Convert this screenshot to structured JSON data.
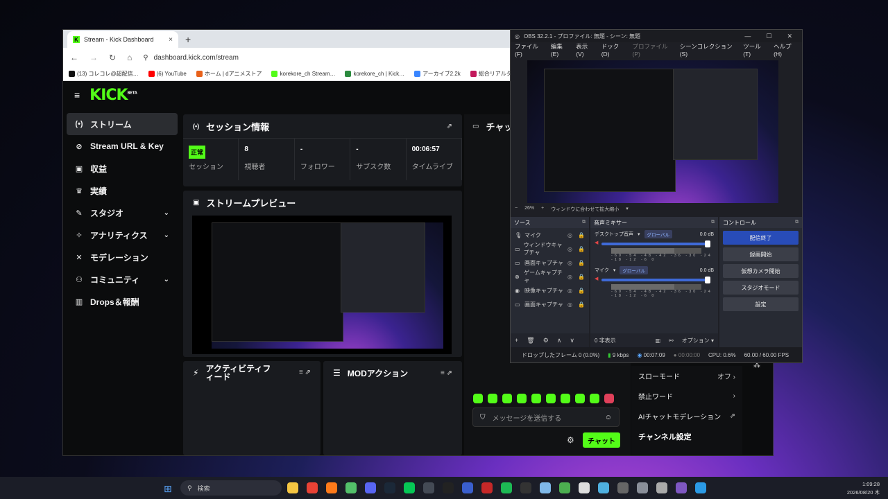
{
  "browser": {
    "tab_title": "Stream - Kick Dashboard",
    "new_tab": "+",
    "close_tab": "×",
    "url": "dashboard.kick.com/stream",
    "bookmarks": [
      {
        "label": "(13) コレコレ@超配信…",
        "color": "#111111"
      },
      {
        "label": "(6) YouTube",
        "color": "#ff0000"
      },
      {
        "label": "ホーム | dアニメストア",
        "color": "#e8611a"
      },
      {
        "label": "korekore_ch Stream…",
        "color": "#53fc18"
      },
      {
        "label": "korekore_ch | Kick…",
        "color": "#2b8a3e"
      },
      {
        "label": "アーカイブ2.2k",
        "color": "#3a86ff"
      },
      {
        "label": "総合リアルタイムランキ…",
        "color": "#c2185b"
      }
    ]
  },
  "kick": {
    "logo": "KICK",
    "logo_beta": "BETA",
    "sidebar": [
      {
        "label": "ストリーム",
        "icon": "broadcast-icon",
        "glyph": "(•)",
        "active": true
      },
      {
        "label": "Stream URL & Key",
        "icon": "link-icon",
        "glyph": "⊘"
      },
      {
        "label": "収益",
        "icon": "money-icon",
        "glyph": "▣"
      },
      {
        "label": "実績",
        "icon": "trophy-icon",
        "glyph": "♛"
      },
      {
        "label": "スタジオ",
        "icon": "studio-icon",
        "glyph": "✎",
        "chevron": "⌄"
      },
      {
        "label": "アナリティクス",
        "icon": "analytics-icon",
        "glyph": "✧",
        "chevron": "⌄"
      },
      {
        "label": "モデレーション",
        "icon": "wrench-icon",
        "glyph": "✕"
      },
      {
        "label": "コミュニティ",
        "icon": "community-icon",
        "glyph": "⚇",
        "chevron": "⌄"
      },
      {
        "label": "Drops＆報酬",
        "icon": "gift-icon",
        "glyph": "▥"
      }
    ],
    "session": {
      "title": "セッション情報",
      "status": "正常",
      "stats": [
        {
          "value": "",
          "label": "セッション"
        },
        {
          "value": "8",
          "label": "視聴者"
        },
        {
          "value": "-",
          "label": "フォロワー"
        },
        {
          "value": "-",
          "label": "サブスク数"
        },
        {
          "value": "00:06:57",
          "label": "タイムライブ"
        }
      ]
    },
    "preview_title": "ストリームプレビュー",
    "activity_title": "アクティビティフィード",
    "mod_title": "MODアクション",
    "chat_title": "チャット",
    "chat_placeholder": "メッセージを送信する",
    "chat_button": "チャット",
    "settings": [
      {
        "label": "スローモード",
        "value": "オフ",
        "glyph": "›"
      },
      {
        "label": "禁止ワード",
        "value": "",
        "glyph": "›"
      },
      {
        "label": "AIチャットモデレーション",
        "value": "",
        "glyph": "⇗"
      }
    ],
    "channel_settings": "チャンネル設定"
  },
  "obs": {
    "title": "OBS 32.2.1 - プロファイル: 無題 - シーン: 無題",
    "menu": [
      {
        "label": "ファイル(F)"
      },
      {
        "label": "編集(E)"
      },
      {
        "label": "表示(V)"
      },
      {
        "label": "ドック(D)"
      },
      {
        "label": "プロファイル(P)",
        "disabled": true
      },
      {
        "label": "シーンコレクション(S)"
      },
      {
        "label": "ツール(T)"
      },
      {
        "label": "ヘルプ(H)"
      }
    ],
    "zoom": "26%",
    "zoom_label": "ウィンドウに合わせて拡大縮小",
    "sources_title": "ソース",
    "sources": [
      {
        "label": "マイク",
        "icon": "mic-icon",
        "glyph": "🎙"
      },
      {
        "label": "ウィンドウキャプチャ",
        "icon": "window-icon",
        "glyph": "▭"
      },
      {
        "label": "画面キャプチャ",
        "icon": "monitor-icon",
        "glyph": "▭"
      },
      {
        "label": "ゲームキャプチャ",
        "icon": "gamepad-icon",
        "glyph": "⊗"
      },
      {
        "label": "映像キャプチャ",
        "icon": "camera-icon",
        "glyph": "◉"
      },
      {
        "label": "画面キャプチャ",
        "icon": "monitor-icon",
        "glyph": "▭"
      }
    ],
    "mixer_title": "音声ミキサー",
    "mixer": [
      {
        "name": "デスクトップ音声",
        "db": "0.0 dB",
        "global": "グローバル"
      },
      {
        "name": "マイク",
        "db": "0.0 dB",
        "global": "グローバル"
      }
    ],
    "meter_scale": "-60 -54 -48 -42 -36 -30 -24 -18 -12 -6 0",
    "hidden_count": "0 非表示",
    "options": "オプション",
    "controls_title": "コントロール",
    "controls": [
      "配信終了",
      "録画開始",
      "仮想カメラ開始",
      "スタジオモード",
      "設定"
    ],
    "status": {
      "dropped": "ドロップしたフレーム 0 (0.0%)",
      "kbps": "9 kbps",
      "stream_time": "00:07:09",
      "rec_time": "00:00:00",
      "cpu": "CPU: 0.6%",
      "fps": "60.00 / 60.00 FPS"
    }
  },
  "taskbar": {
    "search": "検索",
    "time": "1:09:28",
    "date": "2026/08/20 木",
    "apps": [
      {
        "name": "file-explorer-icon",
        "color": "#f5c542"
      },
      {
        "name": "chrome-icon",
        "color": "#e94235"
      },
      {
        "name": "firefox-icon",
        "color": "#ff7a1a"
      },
      {
        "name": "app-icon",
        "color": "#53c06a"
      },
      {
        "name": "discord-icon",
        "color": "#5865f2"
      },
      {
        "name": "steam-icon",
        "color": "#1b2838"
      },
      {
        "name": "line-icon",
        "color": "#06c755"
      },
      {
        "name": "obs-icon",
        "color": "#444a55"
      },
      {
        "name": "audio-icon",
        "color": "#222222"
      },
      {
        "name": "app2-icon",
        "color": "#3a5fcd"
      },
      {
        "name": "app3-icon",
        "color": "#c62828"
      },
      {
        "name": "spotify-icon",
        "color": "#1db954"
      },
      {
        "name": "epic-icon",
        "color": "#333333"
      },
      {
        "name": "notepad-icon",
        "color": "#7fb8e8"
      },
      {
        "name": "minecraft-icon",
        "color": "#4caf50"
      },
      {
        "name": "app4-icon",
        "color": "#dddddd"
      },
      {
        "name": "chat-icon",
        "color": "#4fb0e0"
      },
      {
        "name": "app5-icon",
        "color": "#666666"
      },
      {
        "name": "settings-icon",
        "color": "#8a8f99"
      },
      {
        "name": "shield-icon",
        "color": "#aaaaaa"
      },
      {
        "name": "app6-icon",
        "color": "#7e57c2"
      },
      {
        "name": "edge-icon",
        "color": "#2b9ae6"
      }
    ]
  }
}
